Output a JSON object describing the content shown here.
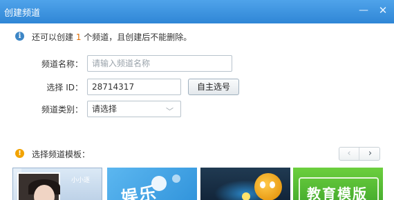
{
  "window": {
    "title": "创建频道",
    "minimize_glyph": "—",
    "close_glyph": "✕"
  },
  "info": {
    "icon": "i",
    "prefix": "还可以创建 ",
    "count": "1",
    "suffix": " 个频道，且创建后不能删除。"
  },
  "form": {
    "name_label": "频道名称：",
    "name_placeholder": "请输入频道名称",
    "id_label": "选择 ID：",
    "id_value": "28714317",
    "choose_button": "自主选号",
    "category_label": "频道类别：",
    "category_value": "请选择",
    "category_arrow": "﹀"
  },
  "templates": {
    "icon": "!",
    "label": "选择频道模板：",
    "prev": "‹",
    "next": "›",
    "items": [
      {
        "text": "小小逐"
      },
      {
        "text": "娱乐"
      },
      {
        "text": ""
      },
      {
        "text": "教育模版"
      }
    ]
  },
  "colors": {
    "titlebar": "#2f86d6",
    "accent_number": "#e06b00"
  }
}
